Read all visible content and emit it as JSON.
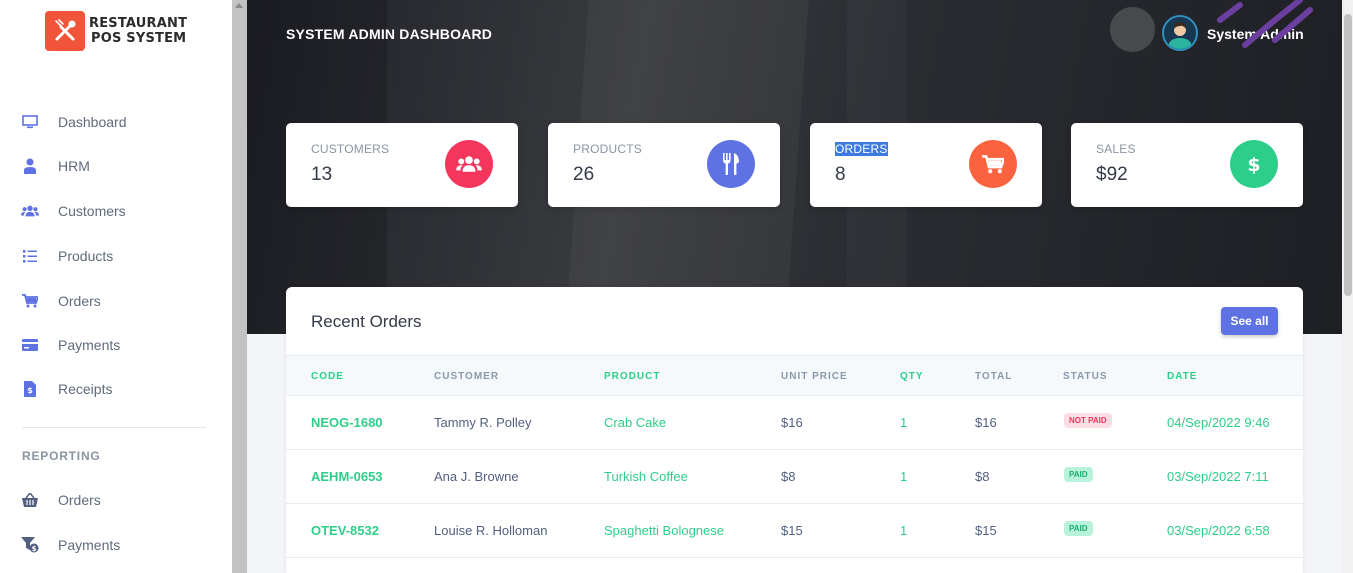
{
  "logo": {
    "line1": "RESTAURANT",
    "line2": "POS SYSTEM",
    "icon": "utensils-icon"
  },
  "sidebar": {
    "items": [
      {
        "label": "Dashboard",
        "icon": "monitor-icon"
      },
      {
        "label": "HRM",
        "icon": "user-tie-icon"
      },
      {
        "label": "Customers",
        "icon": "users-icon"
      },
      {
        "label": "Products",
        "icon": "list-icon"
      },
      {
        "label": "Orders",
        "icon": "cart-icon"
      },
      {
        "label": "Payments",
        "icon": "credit-card-icon"
      },
      {
        "label": "Receipts",
        "icon": "receipt-icon"
      }
    ],
    "reporting_heading": "REPORTING",
    "reporting_items": [
      {
        "label": "Orders",
        "icon": "basket-icon"
      },
      {
        "label": "Payments",
        "icon": "money-filter-icon"
      }
    ]
  },
  "header": {
    "title": "SYSTEM ADMIN DASHBOARD",
    "user_name": "System Admin"
  },
  "stats": [
    {
      "label": "CUSTOMERS",
      "value": "13",
      "icon": "users-icon",
      "color": "#f5365c"
    },
    {
      "label": "PRODUCTS",
      "value": "26",
      "icon": "utensils-icon",
      "color": "#5e72e4"
    },
    {
      "label": "ORDERS",
      "value": "8",
      "icon": "cart-icon",
      "color": "#fb6340"
    },
    {
      "label": "SALES",
      "value": "$92",
      "icon": "dollar-icon",
      "color": "#2dce89"
    }
  ],
  "recent_orders": {
    "title": "Recent Orders",
    "see_all_label": "See all",
    "columns": [
      "CODE",
      "CUSTOMER",
      "PRODUCT",
      "UNIT PRICE",
      "QTY",
      "TOTAL",
      "STATUS",
      "DATE"
    ],
    "rows": [
      {
        "code": "NEOG-1680",
        "customer": "Tammy R. Polley",
        "product": "Crab Cake",
        "unit_price": "$16",
        "qty": "1",
        "total": "$16",
        "status": "NOT PAID",
        "date": "04/Sep/2022 9:46"
      },
      {
        "code": "AEHM-0653",
        "customer": "Ana J. Browne",
        "product": "Turkish Coffee",
        "unit_price": "$8",
        "qty": "1",
        "total": "$8",
        "status": "PAID",
        "date": "03/Sep/2022 7:11"
      },
      {
        "code": "OTEV-8532",
        "customer": "Louise R. Holloman",
        "product": "Spaghetti Bolognese",
        "unit_price": "$15",
        "qty": "1",
        "total": "$15",
        "status": "PAID",
        "date": "03/Sep/2022 6:58"
      }
    ]
  },
  "colors": {
    "accent": "#5e72e4",
    "success": "#2dce89",
    "danger": "#f5365c",
    "warning": "#fb6340",
    "brand": "#f0553a"
  }
}
